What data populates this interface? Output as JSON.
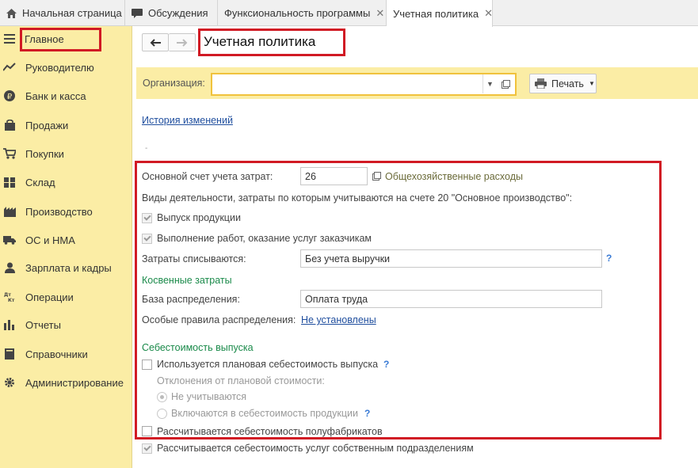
{
  "tabs": [
    {
      "label": "Начальная страница",
      "icon": "home-icon"
    },
    {
      "label": "Обсуждения",
      "icon": "chat-icon"
    },
    {
      "label": "Функсиональность программы",
      "icon": ""
    },
    {
      "label": "Учетная политика",
      "icon": "",
      "active": true
    }
  ],
  "sidebar": {
    "items": [
      {
        "label": "Главное",
        "icon": "menu-icon"
      },
      {
        "label": "Руководителю",
        "icon": "chart-line-icon"
      },
      {
        "label": "Банк и касса",
        "icon": "ruble-icon"
      },
      {
        "label": "Продажи",
        "icon": "shopping-bag-icon"
      },
      {
        "label": "Покупки",
        "icon": "cart-icon"
      },
      {
        "label": "Склад",
        "icon": "warehouse-icon"
      },
      {
        "label": "Производство",
        "icon": "factory-icon"
      },
      {
        "label": "ОС и НМА",
        "icon": "truck-icon"
      },
      {
        "label": "Зарплата и кадры",
        "icon": "person-icon"
      },
      {
        "label": "Операции",
        "icon": "operations-icon"
      },
      {
        "label": "Отчеты",
        "icon": "bar-chart-icon"
      },
      {
        "label": "Справочники",
        "icon": "book-icon"
      },
      {
        "label": "Администрирование",
        "icon": "gear-icon"
      }
    ]
  },
  "page": {
    "title": "Учетная политика",
    "org_label": "Организация:",
    "org_value": "",
    "print_label": "Печать",
    "history_link": "История изменений",
    "dash": "-"
  },
  "form": {
    "cost_account_label": "Основной счет учета затрат:",
    "cost_account_value": "26",
    "cost_account_name": "Общехозяйственные расходы",
    "activities_label": "Виды деятельности, затраты по которым учитываются на счете 20 \"Основное производство\":",
    "release_products": "Выпуск продукции",
    "works_services": "Выполнение работ, оказание услуг заказчикам",
    "costs_written_label": "Затраты списываются:",
    "costs_written_value": "Без учета выручки",
    "indirect_header": "Косвенные затраты",
    "allocation_base_label": "База распределения:",
    "allocation_base_value": "Оплата труда",
    "special_rules_label": "Особые правила распределения:",
    "special_rules_link": "Не установлены",
    "cost_price_header": "Себестоимость выпуска",
    "planned_cost": "Используется плановая себестоимость выпуска",
    "deviations_label": "Отклонения от плановой стоимости:",
    "radio_not_counted": "Не учитываются",
    "radio_included": "Включаются в себестоимость продукции",
    "semi_finished": "Рассчитывается себестоимость полуфабрикатов",
    "own_divisions": "Рассчитывается себестоимость услуг собственным подразделениям",
    "help": "?"
  },
  "colors": {
    "accent_red": "#d11a24",
    "sidebar_bg": "#fbeda5",
    "section_green": "#1a8a4a",
    "link_blue": "#1f4e9e"
  }
}
